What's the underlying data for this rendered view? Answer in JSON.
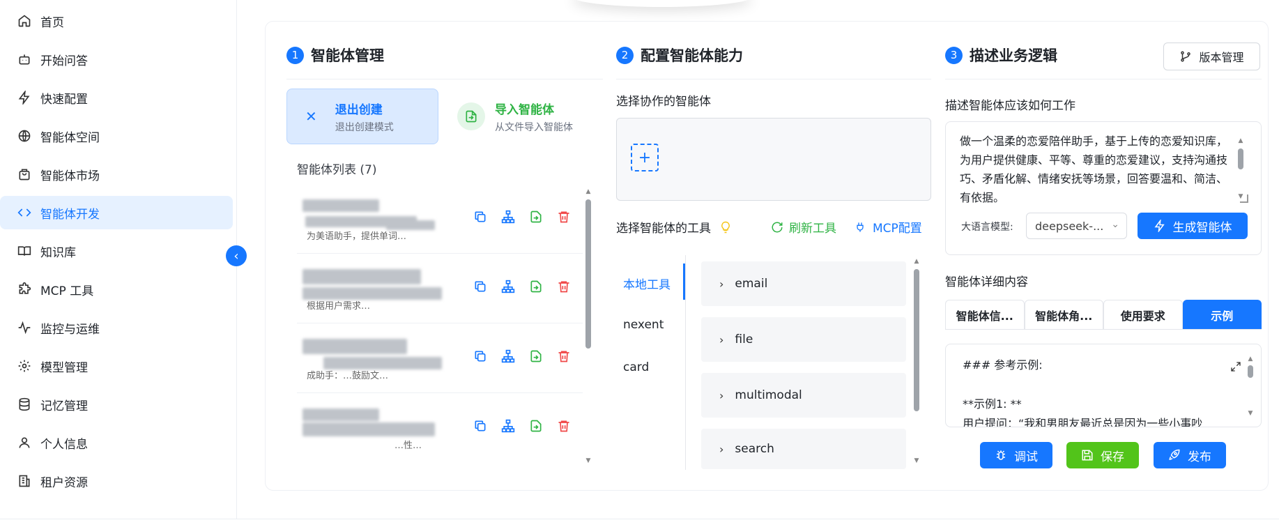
{
  "sidebar": {
    "items": [
      {
        "label": "首页",
        "icon": "home-icon"
      },
      {
        "label": "开始问答",
        "icon": "bot-icon"
      },
      {
        "label": "快速配置",
        "icon": "zap-icon"
      },
      {
        "label": "智能体空间",
        "icon": "globe-icon"
      },
      {
        "label": "智能体市场",
        "icon": "shopping-bag-icon"
      },
      {
        "label": "智能体开发",
        "icon": "code-icon",
        "active": true
      },
      {
        "label": "知识库",
        "icon": "book-icon"
      },
      {
        "label": "MCP 工具",
        "icon": "puzzle-icon"
      },
      {
        "label": "监控与运维",
        "icon": "activity-icon"
      },
      {
        "label": "模型管理",
        "icon": "gear-icon"
      },
      {
        "label": "记忆管理",
        "icon": "database-icon"
      },
      {
        "label": "个人信息",
        "icon": "user-icon"
      },
      {
        "label": "租户资源",
        "icon": "building-icon"
      }
    ],
    "collapse_glyph": "‹"
  },
  "section1": {
    "number": "1",
    "title": "智能体管理",
    "exit_title": "退出创建",
    "exit_subtitle": "退出创建模式",
    "import_title": "导入智能体",
    "import_subtitle": "从文件导入智能体",
    "list_title": "智能体列表 (7)",
    "rows": [
      {
        "text": "为美语助手，提供单词…"
      },
      {
        "text": "根据用户需求…"
      },
      {
        "text": "成助手：…鼓励文…"
      },
      {
        "text": "…性…"
      }
    ]
  },
  "section2": {
    "number": "2",
    "title": "配置智能体能力",
    "collab_label": "选择协作的智能体",
    "tools_label": "选择智能体的工具",
    "refresh_label": "刷新工具",
    "mcp_label": "MCP配置",
    "tool_tabs": [
      "本地工具",
      "nexent",
      "card"
    ],
    "tools": [
      "email",
      "file",
      "multimodal",
      "search"
    ]
  },
  "section3": {
    "number": "3",
    "title": "描述业务逻辑",
    "version_btn": "版本管理",
    "desc_label": "描述智能体应该如何工作",
    "desc_text": "做一个温柔的恋爱陪伴助手，基于上传的恋爱知识库，为用户提供健康、平等、尊重的恋爱建议，支持沟通技巧、矛盾化解、情绪安抚等场景，回答要温和、简洁、有依据。",
    "llm_label": "大语言模型:",
    "llm_value": "deepseek-...",
    "generate_btn": "生成智能体",
    "detail_label": "智能体详细内容",
    "detail_tabs": [
      "智能体信...",
      "智能体角...",
      "使用要求",
      "示例"
    ],
    "example_line1": "### 参考示例:",
    "example_line2": "**示例1: **",
    "example_line3": "用户提问：“我和男朋友最近总是因为一些小事吵",
    "debug_btn": "调试",
    "save_btn": "保存",
    "publish_btn": "发布"
  },
  "colors": {
    "primary": "#1677ff",
    "success": "#2fb344",
    "danger": "#f04848",
    "bulb": "#f5c518"
  }
}
